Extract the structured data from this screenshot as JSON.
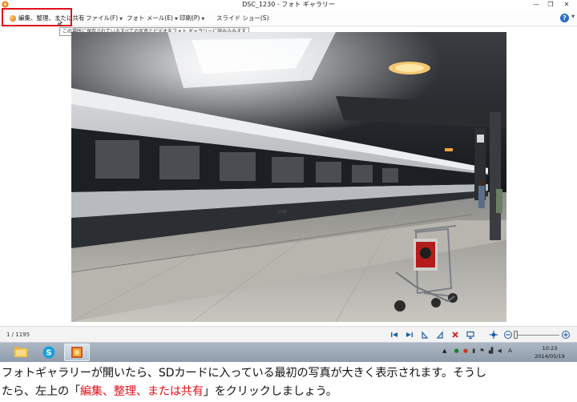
{
  "window": {
    "title": "DSC_1230 - フォト ギャラリー",
    "minimize_glyph": "—",
    "restore_glyph": "❐",
    "close_glyph": "✕"
  },
  "menu": {
    "items": [
      {
        "label": "編集、整理、または共有",
        "icon": "fix-icon"
      },
      {
        "label": "ファイル(F)",
        "arrow": "▼"
      },
      {
        "label": "フォト メール(E)",
        "arrow": "▼"
      },
      {
        "label": "印刷(P)",
        "arrow": "▼"
      },
      {
        "label": "スライド ショー(S)"
      }
    ],
    "help_glyph": "?",
    "help_arrow": "▼",
    "tooltip": "この場所に保存されているすべての写真とビデオをフォト ギャラリーに読み込みます",
    "highlight_color": "#e0101a"
  },
  "viewer": {
    "position_text": "1 / 1195",
    "controls": [
      "previous-icon",
      "next-icon",
      "rotate-left-icon",
      "rotate-right-icon",
      "delete-icon",
      "slideshow-icon",
      "actual-size-icon",
      "zoom-out-icon",
      "zoom-in-icon"
    ],
    "zoom_level": 0.0
  },
  "taskbar": {
    "apps": [
      "file-explorer-icon",
      "skype-icon",
      "photo-gallery-icon"
    ],
    "tray_arrow": "▲",
    "ime_label": "A",
    "time": "10:23",
    "date": "2014/05/19"
  },
  "caption": {
    "line1": "フォトギャラリーが開いたら、SDカードに入っている最初の写真が大きく表示されます。そうし",
    "line2_before": "たら、左上の「",
    "line2_highlight": "編集、整理、または共有",
    "line2_after": "」をクリックしましょう。"
  }
}
